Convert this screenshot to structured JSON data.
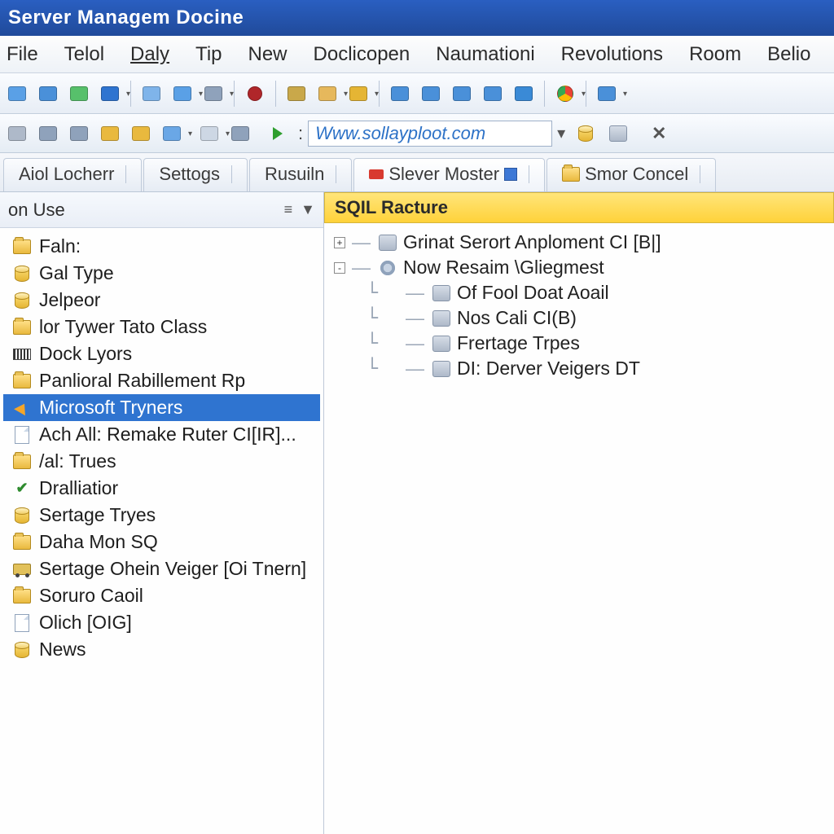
{
  "window": {
    "title": "Server Managem Docine"
  },
  "menu": {
    "items": [
      "File",
      "Telol",
      "Daly",
      "Tip",
      "New",
      "Doclicopen",
      "Naumationi",
      "Revolutions",
      "Room",
      "Belio"
    ],
    "underlined_index": 2
  },
  "address": {
    "prefix": ":",
    "value": "Www.sollayploot.com"
  },
  "tabs": [
    {
      "label": "Aiol Locherr",
      "icon": "none"
    },
    {
      "label": "Settogs",
      "icon": "none"
    },
    {
      "label": "Rusuiln",
      "icon": "none"
    },
    {
      "label": "Slever Moster",
      "icon": "redtag",
      "trailing_icon": "bluetag",
      "active": true
    },
    {
      "label": "Smor Concel",
      "icon": "folder"
    }
  ],
  "left": {
    "title": "on Use",
    "items": [
      {
        "label": "Faln:",
        "icon": "folder"
      },
      {
        "label": "Gal Type",
        "icon": "db"
      },
      {
        "label": "Jelpeor",
        "icon": "db"
      },
      {
        "label": "lor Tywer Tato Class",
        "icon": "folder"
      },
      {
        "label": "Dock Lyors",
        "icon": "keys"
      },
      {
        "label": "Panlioral Rabillement Rp",
        "icon": "folder"
      },
      {
        "label": "Microsoft Tryners",
        "icon": "arrow",
        "selected": true
      },
      {
        "label": "Ach All: Remake Ruter CI[IR]...",
        "icon": "page"
      },
      {
        "label": "/al: Trues",
        "icon": "folder"
      },
      {
        "label": "Dralliatior",
        "icon": "check"
      },
      {
        "label": "Sertage Tryes",
        "icon": "db"
      },
      {
        "label": "Daha Mon SQ",
        "icon": "folder"
      },
      {
        "label": "Sertage Ohein Veiger [Oi Tnern]",
        "icon": "truck"
      },
      {
        "label": "Soruro Caoil",
        "icon": "folder"
      },
      {
        "label": "Olich [OIG]",
        "icon": "page"
      },
      {
        "label": "News",
        "icon": "db"
      }
    ]
  },
  "right": {
    "title": "SQIL Racture",
    "nodes": [
      {
        "depth": 0,
        "expander": "+",
        "icon": "gray",
        "label": "Grinat Serort Anploment CI [B|]"
      },
      {
        "depth": 0,
        "expander": "-",
        "icon": "gear",
        "label": "Now Resaim \\Gliegmest"
      },
      {
        "depth": 1,
        "expander": "",
        "icon": "gray",
        "label": "Of Fool Doat Aoail"
      },
      {
        "depth": 1,
        "expander": "",
        "icon": "gray",
        "label": "Nos Cali CI(B)"
      },
      {
        "depth": 1,
        "expander": "",
        "icon": "gray",
        "label": "Frertage Trpes"
      },
      {
        "depth": 1,
        "expander": "",
        "icon": "gray",
        "label": "DI: Derver Veigers DT"
      }
    ]
  },
  "toolbar1_icons": [
    "doc",
    "grid",
    "net",
    "blue",
    "sep",
    "copy",
    "stack",
    "gear",
    "sep",
    "seal",
    "sep",
    "find",
    "pencil",
    "db",
    "sep",
    "panel",
    "panes",
    "monitor",
    "monitor2",
    "down",
    "sep",
    "chrome",
    "sep",
    "cut"
  ],
  "toolbar2_icons": [
    "gray",
    "target",
    "swap",
    "folder",
    "folder2",
    "chat",
    "sep",
    "window",
    "fx",
    "sep",
    "play"
  ]
}
